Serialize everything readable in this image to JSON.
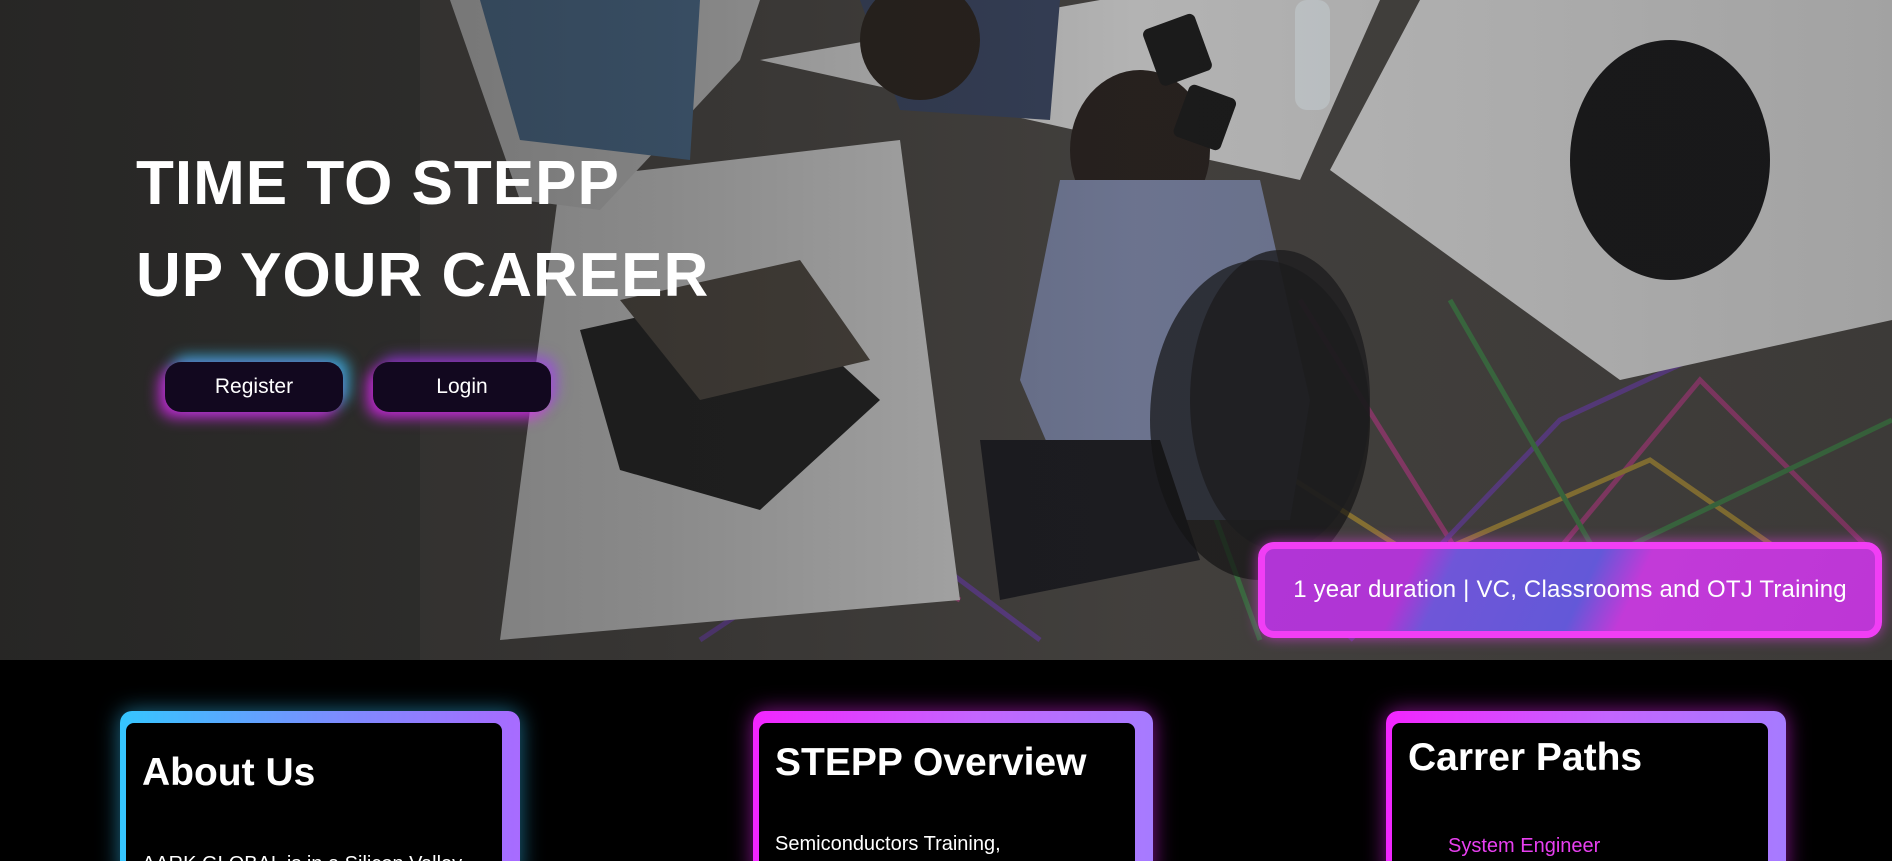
{
  "hero": {
    "title_line1": "TIME TO STEPP",
    "title_line2": "UP YOUR CAREER",
    "register_label": "Register",
    "login_label": "Login",
    "badge_text": "1 year duration | VC, Classrooms and OTJ Training"
  },
  "cards": {
    "about": {
      "title": "About Us",
      "text": "AARK GLOBAL is in a Silicon Valley"
    },
    "overview": {
      "title": "STEPP Overview",
      "text": "Semiconductors Training,"
    },
    "career": {
      "title": "Carrer Paths",
      "link": "System Engineer"
    }
  },
  "colors": {
    "background": "#000000",
    "button_bg": "#12081f",
    "neon_pink": "#f13ef5",
    "neon_cyan": "#35c6ff",
    "neon_violet": "#a67bff",
    "link_pink": "#e83ff0"
  }
}
